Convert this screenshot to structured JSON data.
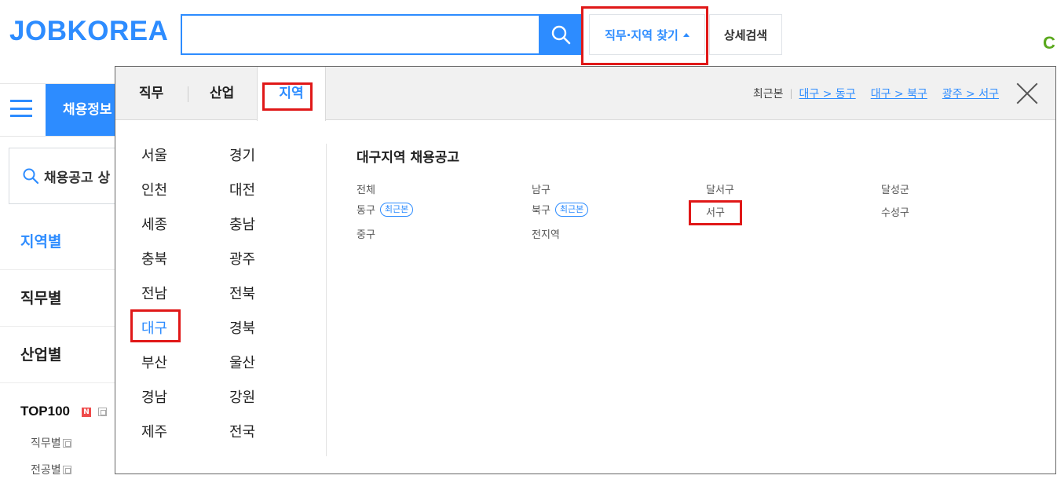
{
  "header": {
    "logo": "JOBKOREA",
    "search_placeholder": "",
    "find_label": "직무·지역 찾기",
    "detail_label": "상세검색",
    "corner_ad": "C"
  },
  "sidebar": {
    "menu_tab": "채용정보",
    "search_label": "채용공고 상",
    "items": [
      {
        "label": "지역별"
      },
      {
        "label": "직무별"
      },
      {
        "label": "산업별"
      }
    ],
    "top100": "TOP100",
    "badge": "N",
    "links": [
      "직무별",
      "전공별"
    ]
  },
  "panel": {
    "tabs": [
      "직무",
      "산업",
      "지역"
    ],
    "recent_label": "최근본",
    "recent_links": [
      "대구 > 동구",
      "대구 > 북구",
      "광주 > 서구"
    ],
    "regions_left": [
      "서울",
      "인천",
      "세종",
      "충북",
      "전남",
      "대구",
      "부산",
      "경남",
      "제주"
    ],
    "regions_right": [
      "경기",
      "대전",
      "충남",
      "광주",
      "전북",
      "경북",
      "울산",
      "강원",
      "전국"
    ],
    "district_title": "대구지역 채용공고",
    "districts": [
      {
        "name": "전체"
      },
      {
        "name": "남구"
      },
      {
        "name": "달서구"
      },
      {
        "name": "달성군"
      },
      {
        "name": "동구",
        "badge": "최근본"
      },
      {
        "name": "북구",
        "badge": "최근본"
      },
      {
        "name": "서구"
      },
      {
        "name": "수성구"
      },
      {
        "name": "중구"
      },
      {
        "name": "전지역"
      }
    ]
  },
  "colors": {
    "accent": "#2d8cff",
    "highlight": "#e01818"
  }
}
